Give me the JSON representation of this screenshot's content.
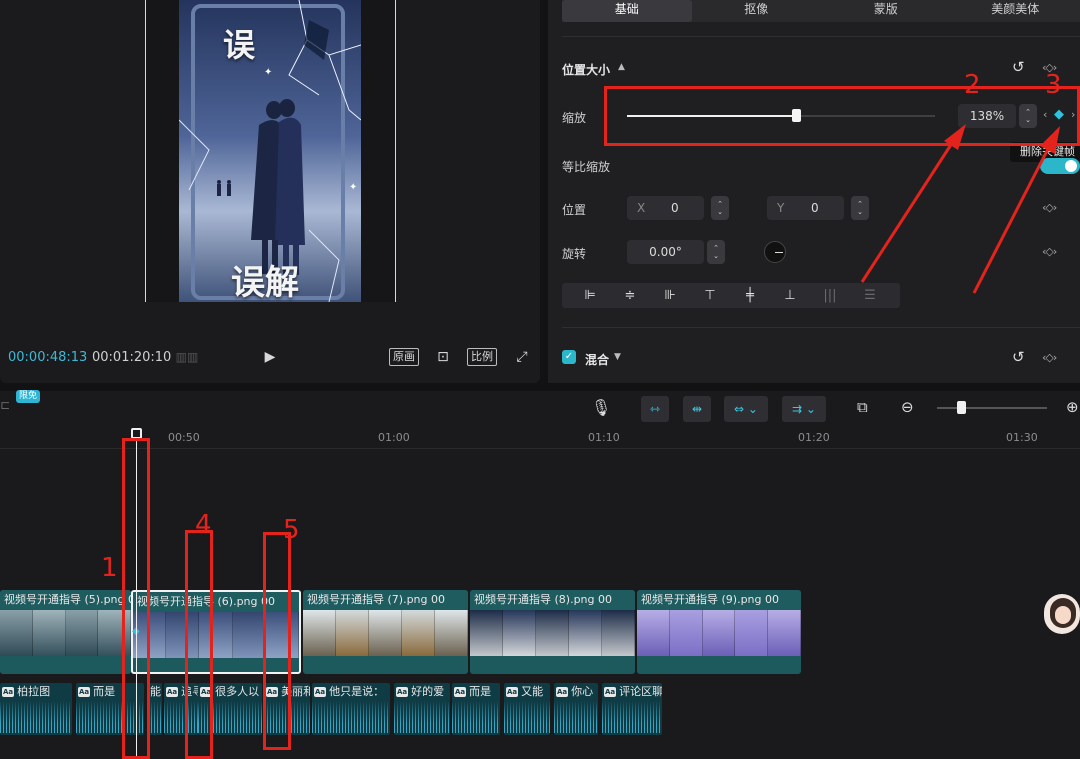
{
  "preview": {
    "canvas_text_top": "误",
    "canvas_text_bottom": "误解",
    "time_current": "00:00:48:13",
    "time_total": "00:01:20:10",
    "btn_original": "原画",
    "btn_ratio": "比例"
  },
  "inspector": {
    "tabs": [
      "基础",
      "抠像",
      "蒙版",
      "美颜美体"
    ],
    "section_position_size": "位置大小",
    "scale_label": "缩放",
    "scale_value": "138%",
    "scale_slider_fraction": 0.55,
    "uniform_scale_label": "等比缩放",
    "tooltip_text": "删除关键帧",
    "position_label": "位置",
    "pos_x_label": "X",
    "pos_x_value": "0",
    "pos_y_label": "Y",
    "pos_y_value": "0",
    "rotate_label": "旋转",
    "rotate_value": "0.00°",
    "blend_label": "混合"
  },
  "timeline": {
    "free_badge": "限免",
    "ruler": [
      "00:50",
      "01:00",
      "01:10",
      "01:20",
      "01:30"
    ],
    "video_clips": [
      {
        "label": "视频号开通指导 (5).png",
        "dur": "00"
      },
      {
        "label": "视频号开通指导 (6).png",
        "dur": "00"
      },
      {
        "label": "视频号开通指导 (7).png",
        "dur": "00"
      },
      {
        "label": "视频号开通指导 (8).png",
        "dur": "00"
      },
      {
        "label": "视频号开通指导 (9).png",
        "dur": "00"
      }
    ],
    "audio_clips": [
      "柏拉图",
      "而是",
      "能",
      "追寻",
      "很多人以",
      "美丽和",
      "他只是说：",
      "好的爱",
      "而是",
      "又能",
      "你心",
      "评论区聊"
    ]
  },
  "annotations": [
    "1",
    "2",
    "3",
    "4",
    "5"
  ],
  "colors": {
    "accent": "#3fb8d6",
    "annotation_red": "#e4241c",
    "clip_teal": "#1d5a5e"
  }
}
